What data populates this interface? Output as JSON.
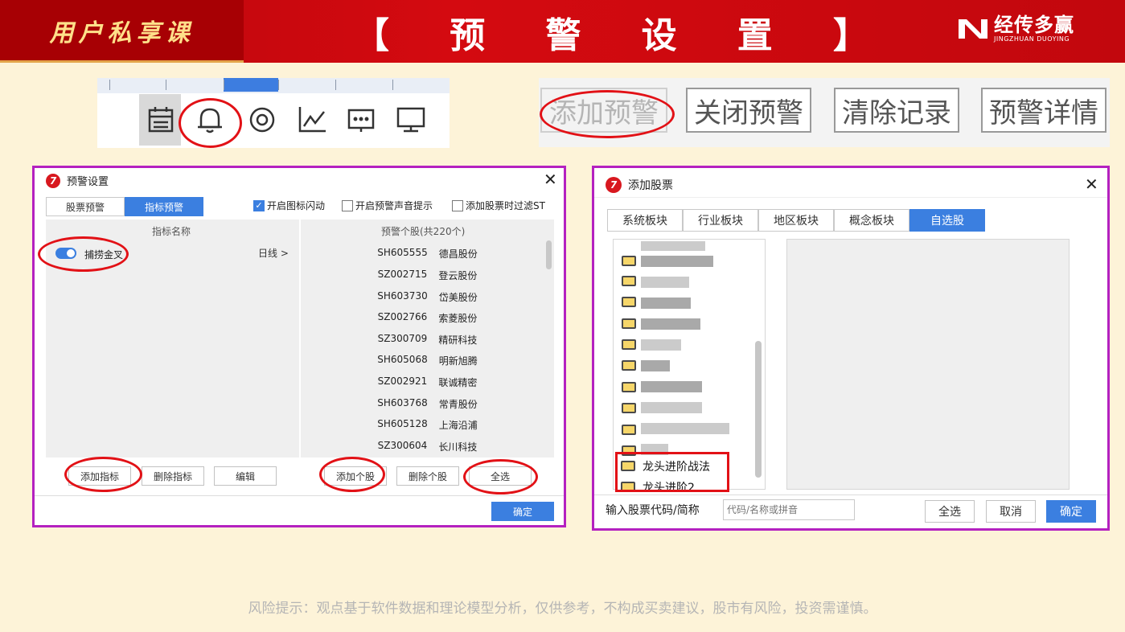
{
  "header": {
    "badge": "用户私享课",
    "title_chars": [
      "【",
      "预",
      "警",
      "设",
      "置",
      "】"
    ],
    "brand_name": "经传多赢",
    "brand_sub": "JINGZHUAN DUOYING"
  },
  "toolbar": {
    "icons": [
      "calendar-icon",
      "bell-icon",
      "target-icon",
      "line-chart-icon",
      "message-icon",
      "monitor-icon"
    ]
  },
  "action_buttons": [
    "添加预警",
    "关闭预警",
    "清除记录",
    "预警详情"
  ],
  "warning_dialog": {
    "title": "预警设置",
    "tabs": [
      "股票预警",
      "指标预警"
    ],
    "options": [
      {
        "label": "开启图标闪动",
        "checked": true
      },
      {
        "label": "开启预警声音提示",
        "checked": false
      },
      {
        "label": "添加股票时过滤ST",
        "checked": false
      }
    ],
    "indicator_header": "指标名称",
    "indicator": {
      "name": "捕捞金叉",
      "period": "日线 >",
      "enabled": true
    },
    "stock_header": "预警个股(共220个)",
    "stocks": [
      {
        "code": "SH605555",
        "name": "德昌股份"
      },
      {
        "code": "SZ002715",
        "name": "登云股份"
      },
      {
        "code": "SH603730",
        "name": "岱美股份"
      },
      {
        "code": "SZ002766",
        "name": "索菱股份"
      },
      {
        "code": "SZ300709",
        "name": "精研科技"
      },
      {
        "code": "SH605068",
        "name": "明新旭腾"
      },
      {
        "code": "SZ002921",
        "name": "联诚精密"
      },
      {
        "code": "SH603768",
        "name": "常青股份"
      },
      {
        "code": "SH605128",
        "name": "上海沿浦"
      },
      {
        "code": "SZ300604",
        "name": "长川科技"
      }
    ],
    "buttons": {
      "add_indicator": "添加指标",
      "del_indicator": "删除指标",
      "edit": "编辑",
      "add_stock": "添加个股",
      "del_stock": "删除个股",
      "select_all": "全选",
      "ok": "确定"
    }
  },
  "add_dialog": {
    "title": "添加股票",
    "tabs": [
      "系统板块",
      "行业板块",
      "地区板块",
      "概念板块",
      "自选股"
    ],
    "folders": [
      "龙头进阶战法",
      "龙头进阶2"
    ],
    "input_label": "输入股票代码/简称",
    "input_placeholder": "代码/名称或拼音",
    "buttons": {
      "select_all": "全选",
      "cancel": "取消",
      "ok": "确定"
    }
  },
  "risk_notice": "风险提示：观点基于软件数据和理论模型分析，仅供参考，不构成买卖建议，股市有风险，投资需谨慎。",
  "colors": {
    "accent": "#3b7fe0",
    "header_red": "#c9070d",
    "highlight_ring": "#e21116",
    "dialog_border": "#b421c0"
  }
}
